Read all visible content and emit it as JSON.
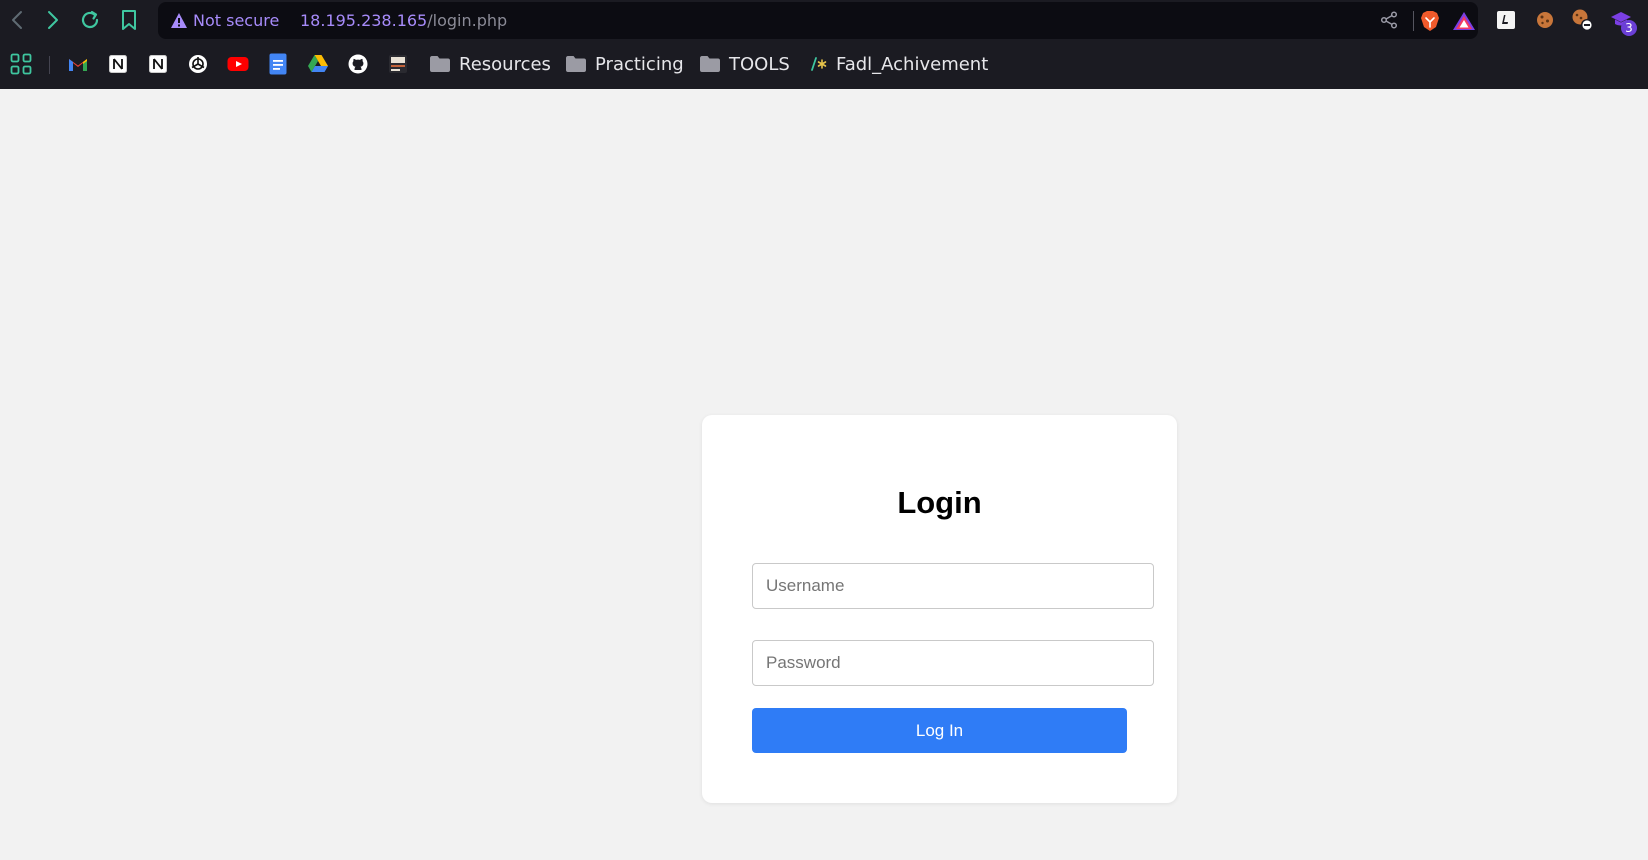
{
  "browser": {
    "security_label": "Not secure",
    "url_host": "18.195.238.165",
    "url_path": "/login.php",
    "extension_badge": "3",
    "bookmarks": {
      "folders": [
        {
          "label": "Resources"
        },
        {
          "label": "Practicing"
        },
        {
          "label": "TOOLS"
        }
      ],
      "fadl_label": "Fadl_Achivement"
    }
  },
  "login": {
    "title": "Login",
    "username_placeholder": "Username",
    "password_placeholder": "Password",
    "submit_label": "Log In"
  },
  "colors": {
    "accent": "#2f7cf6",
    "chrome_bg": "#1b1b22",
    "url_host": "#a78bfa",
    "page_bg": "#f2f2f2"
  }
}
